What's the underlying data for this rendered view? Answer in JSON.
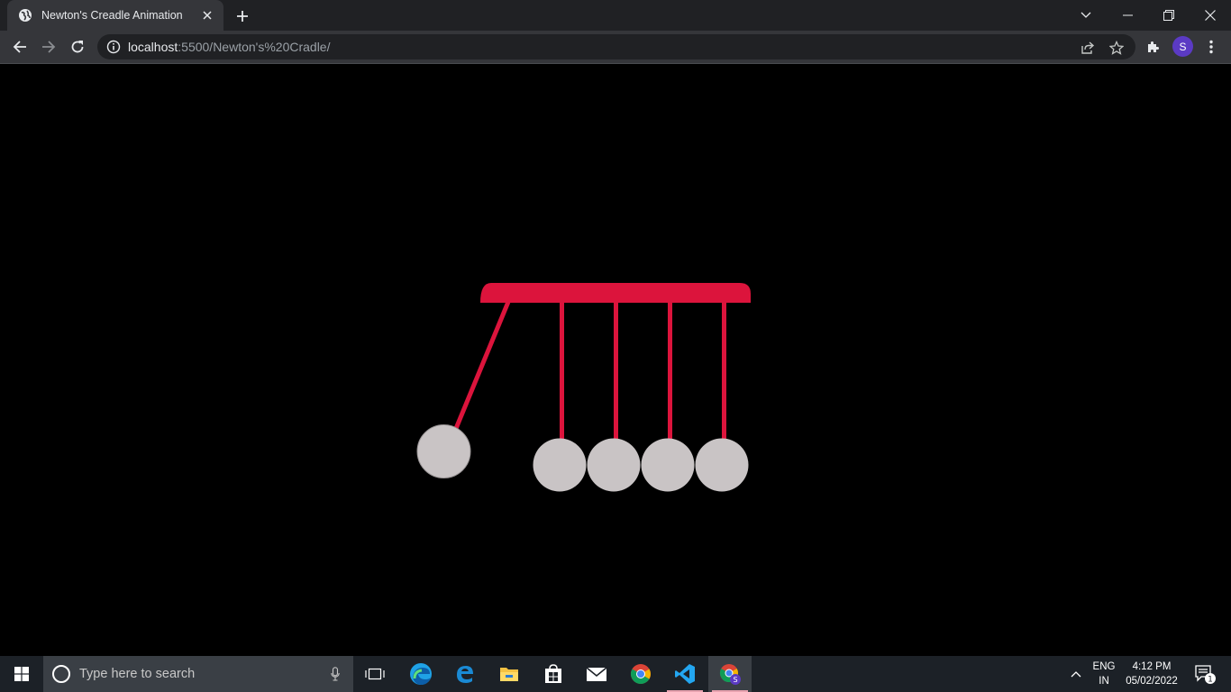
{
  "browser": {
    "tab_title": "Newton's Creadle Animation",
    "url_host": "localhost",
    "url_path": ":5500/Newton's%20Cradle/",
    "profile_initial": "S"
  },
  "page": {
    "background": "#000000",
    "frame_color": "#dc143c",
    "ball_color": "#c9c4c5",
    "ball_count": 5
  },
  "taskbar": {
    "search_placeholder": "Type here to search",
    "apps": [
      "task-view",
      "edge",
      "edge-legacy",
      "file-explorer",
      "microsoft-store",
      "mail",
      "chrome",
      "vscode",
      "chrome-profile"
    ],
    "lang_top": "ENG",
    "lang_bottom": "IN",
    "time": "4:12 PM",
    "date": "05/02/2022",
    "notification_count": "1"
  }
}
